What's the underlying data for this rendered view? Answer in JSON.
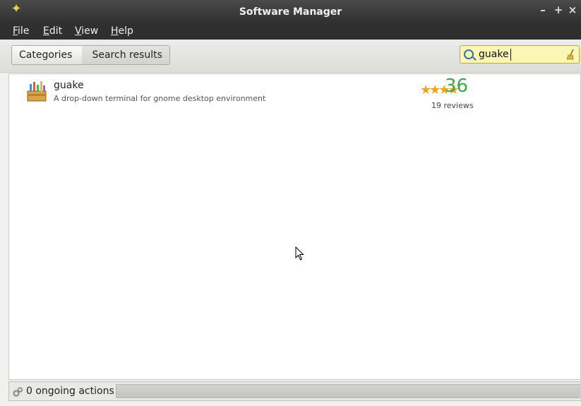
{
  "window": {
    "title": "Software Manager",
    "minimize_label": "–",
    "maximize_label": "+",
    "close_label": "×",
    "app_icon": "sparkle-icon"
  },
  "menu": {
    "items": [
      {
        "key": "F",
        "rest": "ile"
      },
      {
        "key": "E",
        "rest": "dit"
      },
      {
        "key": "V",
        "rest": "iew"
      },
      {
        "key": "H",
        "rest": "elp"
      }
    ]
  },
  "breadcrumb": {
    "categories": "Categories",
    "search_results": "Search results"
  },
  "search": {
    "value": "guake",
    "icon": "search-icon",
    "clear_icon": "broom-icon"
  },
  "results": [
    {
      "name": "guake",
      "description": "A drop-down terminal for gnome desktop environment",
      "stars": "★★★★",
      "score": "36",
      "reviews": "19 reviews"
    }
  ],
  "status": {
    "text": "0 ongoing actions"
  },
  "colors": {
    "titlebar": "#2f2f2f",
    "search_bg": "#fbf6b4",
    "star": "#f0a41c",
    "score": "#3aa64a"
  }
}
